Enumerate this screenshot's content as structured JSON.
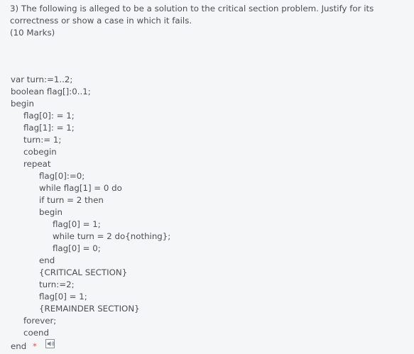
{
  "question": {
    "line1": "3) The following is alleged to be a solution to the critical section problem. Justify for its",
    "line2": "correctness or show a case in which it fails.",
    "marks": "(10 Marks)"
  },
  "code": {
    "lines": [
      "var turn:=1..2;",
      "boolean flag[]:0..1;",
      "begin",
      "flag[0]: = 1;",
      "flag[1]: = 1;",
      "turn:= 1;",
      "cobegin",
      "repeat",
      "flag[0]:=0;",
      "while flag[1] = 0 do",
      "if turn = 2 then",
      "begin",
      "flag[0] = 1;",
      "while turn = 2 do{nothing};",
      "flag[0] = 0;",
      "end",
      "{CRITICAL SECTION}",
      "turn:=2;",
      "flag[0] = 1;",
      "{REMAINDER SECTION}",
      "forever;",
      "coend"
    ],
    "end_label": "end",
    "required_marker": "*"
  },
  "icons": {
    "audio": "speaker-icon"
  }
}
